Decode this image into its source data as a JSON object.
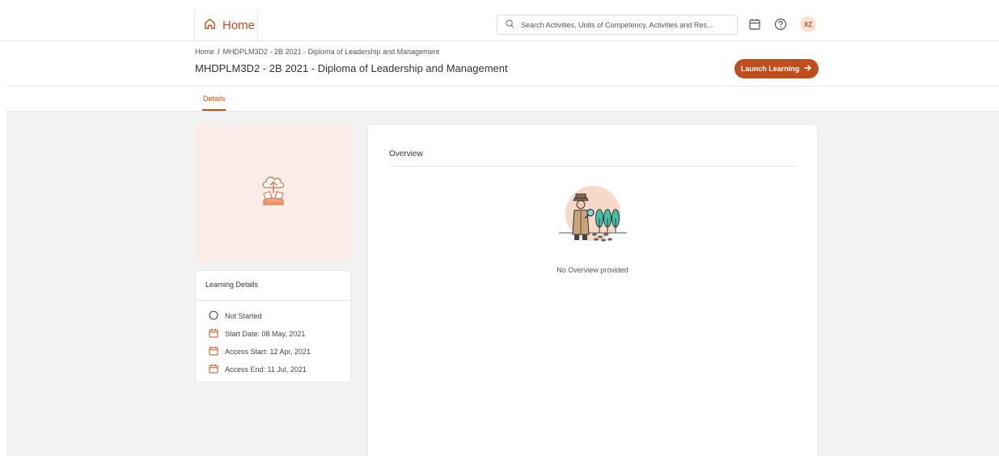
{
  "topbar": {
    "home_label": "Home",
    "search_placeholder": "Search Activities, Units of Competency, Activities and Res...",
    "avatar_initials": "XZ"
  },
  "breadcrumb": {
    "root": "Home",
    "separator": "/",
    "current": "MHDPLM3D2 - 2B 2021 - Diploma of Leadership and Management"
  },
  "page": {
    "title": "MHDPLM3D2 - 2B 2021 - Diploma of Leadership and Management",
    "launch_label": "Launch Learning"
  },
  "tabs": [
    {
      "label": "Details",
      "active": true
    }
  ],
  "learning_details": {
    "title": "Learning Details",
    "items": [
      {
        "icon": "circle-status-icon",
        "text": "Not Started"
      },
      {
        "icon": "calendar-icon",
        "text": "Start Date: 08 May, 2021"
      },
      {
        "icon": "calendar-icon",
        "text": "Access Start: 12 Apr, 2021"
      },
      {
        "icon": "calendar-icon",
        "text": "Access End: 11 Jul, 2021"
      }
    ]
  },
  "overview": {
    "title": "Overview",
    "empty_text": "No Overview provided"
  },
  "colors": {
    "accent": "#c2501f",
    "button": "#bf4e1e",
    "thumb_bg": "#faece6",
    "page_bg": "#f2f2f2"
  }
}
